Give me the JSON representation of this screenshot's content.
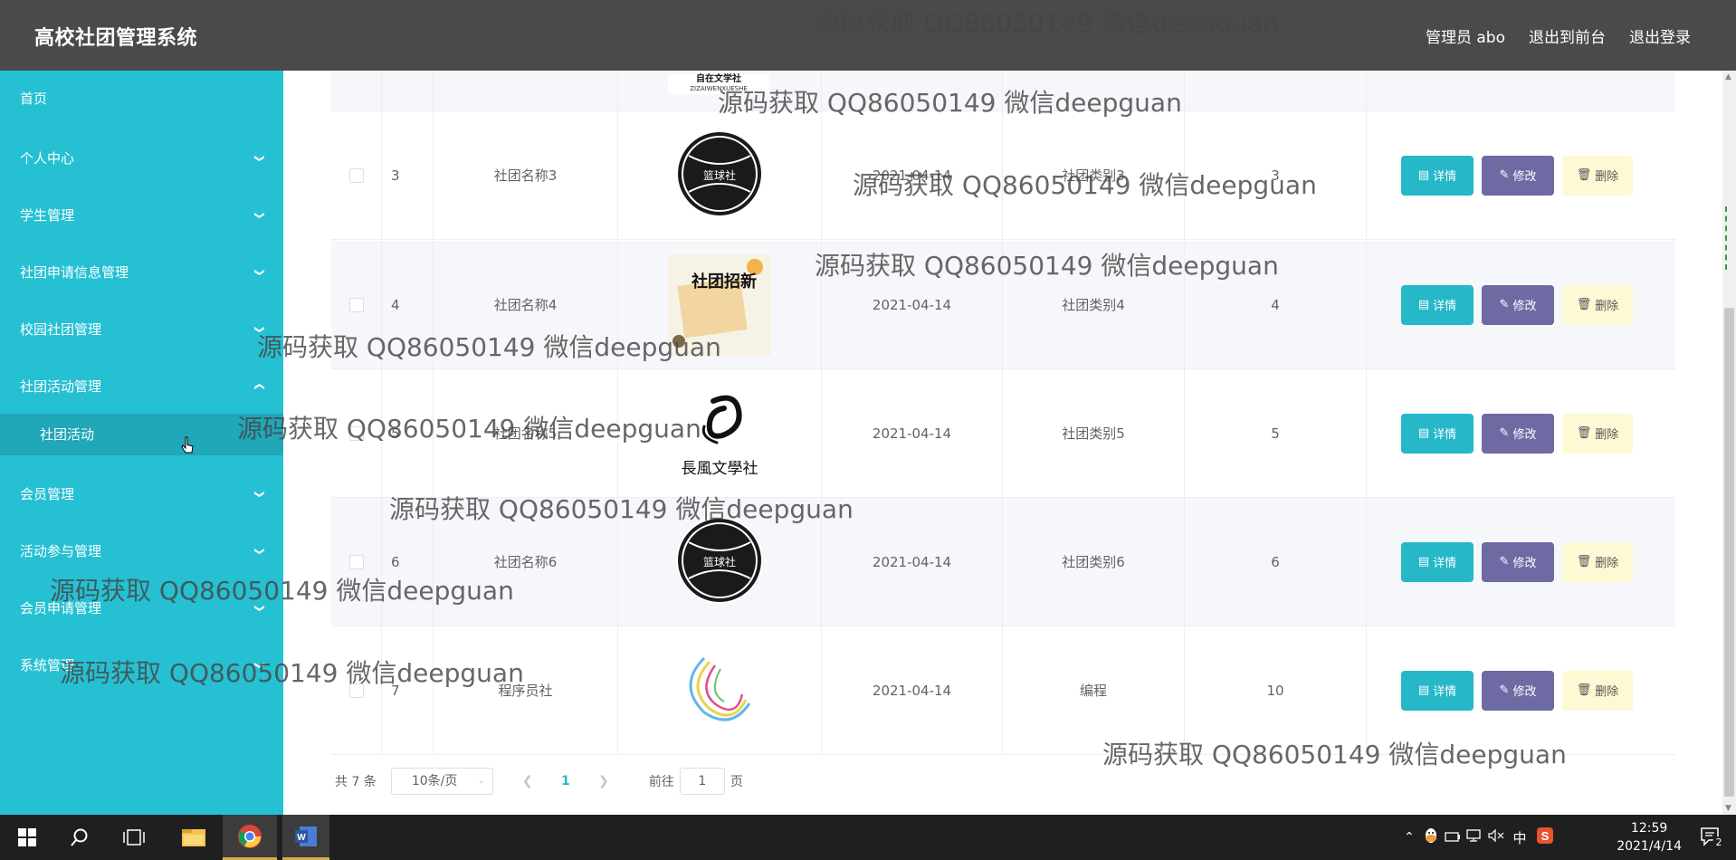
{
  "header": {
    "title": "高校社团管理系统",
    "admin": "管理员 abo",
    "front": "退出到前台",
    "logout": "退出登录"
  },
  "sidebar": {
    "items": [
      {
        "label": "首页",
        "chevron": ""
      },
      {
        "label": "个人中心",
        "chevron": "down"
      },
      {
        "label": "学生管理",
        "chevron": "down"
      },
      {
        "label": "社团申请信息管理",
        "chevron": "down"
      },
      {
        "label": "校园社团管理",
        "chevron": "down"
      },
      {
        "label": "社团活动管理",
        "chevron": "up"
      },
      {
        "label": "社团活动",
        "sub": true
      },
      {
        "label": "会员管理",
        "chevron": "down"
      },
      {
        "label": "活动参与管理",
        "chevron": "down"
      },
      {
        "label": "会员申请管理",
        "chevron": "down"
      },
      {
        "label": "系统管理",
        "chevron": "down"
      }
    ]
  },
  "table": {
    "top_logo_text": "自在文学社",
    "top_logo_sub": "ZIZAIWENXUESHE",
    "rows": [
      {
        "id": "3",
        "name": "社团名称3",
        "date": "2021-04-14",
        "category": "社团类别3",
        "count": "3",
        "logo": "basketball",
        "logo_text": "篮球社"
      },
      {
        "id": "4",
        "name": "社团名称4",
        "date": "2021-04-14",
        "category": "社团类别4",
        "count": "4",
        "logo": "recruit-poster",
        "logo_text": "社团招新"
      },
      {
        "id": "5",
        "name": "社团名称5",
        "date": "2021-04-14",
        "category": "社团类别5",
        "count": "5",
        "logo": "changfeng",
        "logo_text": "長風文學社"
      },
      {
        "id": "6",
        "name": "社团名称6",
        "date": "2021-04-14",
        "category": "社团类别6",
        "count": "6",
        "logo": "basketball",
        "logo_text": "篮球社"
      },
      {
        "id": "7",
        "name": "程序员社",
        "date": "2021-04-14",
        "category": "编程",
        "count": "10",
        "logo": "swirl",
        "logo_text": ""
      }
    ],
    "detail_label": "详情",
    "edit_label": "修改",
    "delete_label": "删除"
  },
  "pagination": {
    "total": "共 7 条",
    "page_size": "10条/页",
    "current": "1",
    "goto_prefix": "前往",
    "goto_value": "1",
    "goto_suffix": "页"
  },
  "watermark": "源码获取 QQ86050149 微信deepguan",
  "taskbar": {
    "time": "12:59",
    "date": "2021/4/14",
    "ime": "中",
    "notif_count": "2"
  },
  "colors": {
    "header_bg": "#4a4a4a",
    "sidebar_bg": "#26c0d3",
    "btn_detail": "#26b7c9",
    "btn_edit": "#6e6aa3",
    "btn_delete": "#fdf9d4"
  }
}
